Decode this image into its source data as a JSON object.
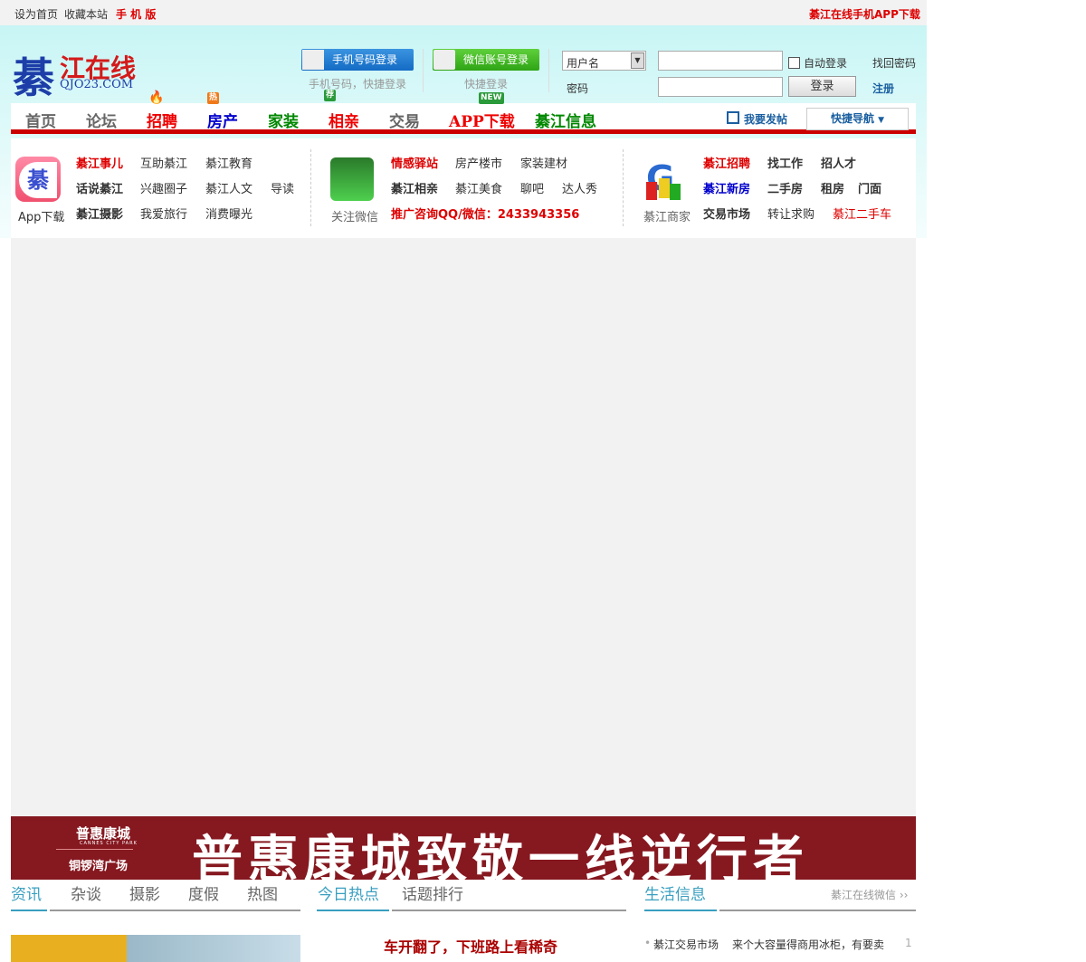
{
  "topbar": {
    "set_home": "设为首页",
    "bookmark": "收藏本站",
    "mobile": "手 机 版",
    "app_download": "綦江在线手机APP下载"
  },
  "logo": {
    "char": "綦",
    "name": "江在线",
    "domain": "QJO23.COM"
  },
  "login": {
    "phone_btn": "手机号码登录",
    "phone_sub": "手机号码，快捷登录",
    "wechat_btn": "微信账号登录",
    "wechat_sub": "快捷登录",
    "username_select": "用户名",
    "password_label": "密码",
    "auto_login": "自动登录",
    "forgot": "找回密码",
    "submit": "登录",
    "register": "注册"
  },
  "nav": {
    "items": [
      {
        "label": "首页",
        "color": "#666"
      },
      {
        "label": "论坛",
        "color": "#666"
      },
      {
        "label": "招聘",
        "color": "#e00"
      },
      {
        "label": "房产",
        "color": "#00c"
      },
      {
        "label": "家装",
        "color": "#080"
      },
      {
        "label": "相亲",
        "color": "#e00"
      },
      {
        "label": "交易",
        "color": "#666"
      },
      {
        "label": "APP下载",
        "color": "#e00"
      },
      {
        "label": "綦江信息",
        "color": "#080"
      }
    ],
    "badges": {
      "hot": "热",
      "rec": "荐",
      "new": "NEW"
    },
    "post": "我要发帖",
    "quick_nav": "快捷导航"
  },
  "quick": {
    "app_label": "App下载",
    "wechat_label": "关注微信",
    "shop_label": "綦江商家",
    "col1": [
      [
        "綦江事儿",
        "互助綦江",
        "綦江教育"
      ],
      [
        "话说綦江",
        "兴趣圈子",
        "綦江人文",
        "导读"
      ],
      [
        "綦江摄影",
        "我爱旅行",
        "消费曝光"
      ]
    ],
    "col2": [
      [
        "情感驿站",
        "房产楼市",
        "家装建材"
      ],
      [
        "綦江相亲",
        "綦江美食",
        "聊吧",
        "达人秀"
      ],
      [
        "推广咨询QQ/微信：2433943356"
      ]
    ],
    "col3": [
      [
        "綦江招聘",
        "找工作",
        "招人才"
      ],
      [
        "綦江新房",
        "二手房",
        "租房",
        "门面"
      ],
      [
        "交易市场",
        "转让求购",
        "綦江二手车"
      ]
    ]
  },
  "banner": {
    "brand": "普惠康城",
    "brand_en": "CANNES CITY PARK",
    "sub": "铜锣湾广场",
    "slogan": "普惠康城致敬一线逆行者"
  },
  "tabs1": [
    "资讯",
    "杂谈",
    "摄影",
    "度假",
    "热图"
  ],
  "tabs2": [
    "今日热点",
    "话题排行"
  ],
  "tabs3": {
    "title": "生活信息",
    "more": "綦江在线微信"
  },
  "headline": "车开翻了，下班路上看稀奇",
  "life_item": {
    "category": "綦江交易市场",
    "text": "来个大容量得商用冰柜，有要卖",
    "count": "1"
  }
}
